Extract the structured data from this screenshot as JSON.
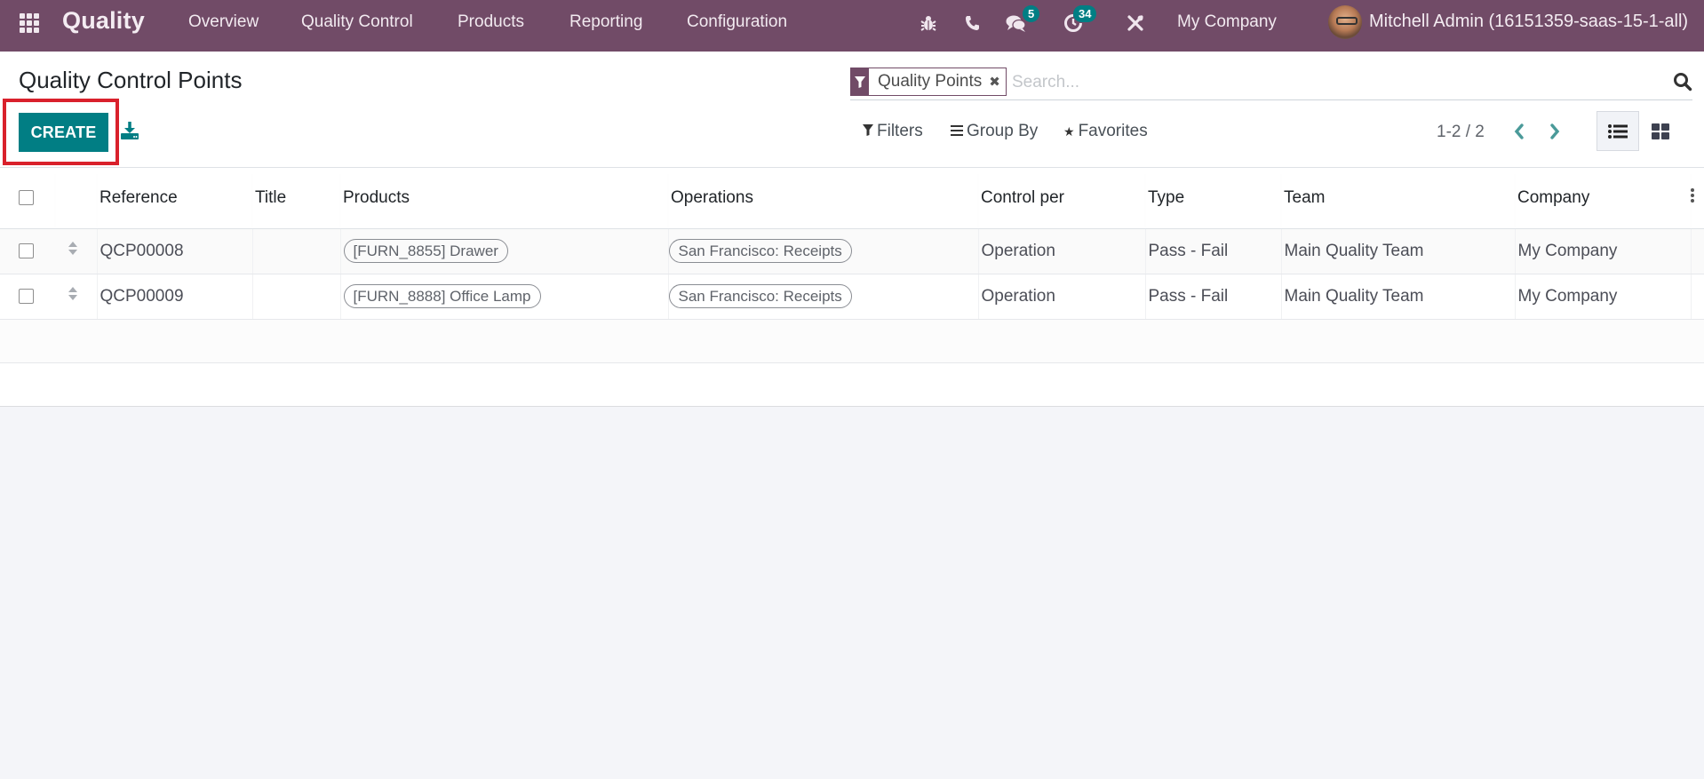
{
  "navbar": {
    "app_name": "Quality",
    "menu": [
      "Overview",
      "Quality Control",
      "Products",
      "Reporting",
      "Configuration"
    ],
    "messages_badge": "5",
    "activities_badge": "34",
    "company": "My Company",
    "user": "Mitchell Admin (16151359-saas-15-1-all)",
    "icons": [
      "bug-icon",
      "phone-icon",
      "chat-icon",
      "clock-icon",
      "tools-icon"
    ]
  },
  "control_panel": {
    "title": "Quality Control Points",
    "create_label": "CREATE",
    "search": {
      "facet_label": "Quality Points",
      "placeholder": "Search..."
    },
    "filters_label": "Filters",
    "group_by_label": "Group By",
    "favorites_label": "Favorites",
    "pager": "1-2 / 2",
    "active_view": "list"
  },
  "table": {
    "columns": [
      "Reference",
      "Title",
      "Products",
      "Operations",
      "Control per",
      "Type",
      "Team",
      "Company"
    ],
    "rows": [
      {
        "reference": "QCP00008",
        "title": "",
        "product": "[FURN_8855] Drawer",
        "operation": "San Francisco: Receipts",
        "control_per": "Operation",
        "type": "Pass - Fail",
        "team": "Main Quality Team",
        "company": "My Company"
      },
      {
        "reference": "QCP00009",
        "title": "",
        "product": "[FURN_8888] Office Lamp",
        "operation": "San Francisco: Receipts",
        "control_per": "Operation",
        "type": "Pass - Fail",
        "team": "Main Quality Team",
        "company": "My Company"
      }
    ]
  },
  "colors": {
    "brand": "#714b67",
    "primary_button": "#017e84",
    "highlight_box": "#d9212c"
  }
}
